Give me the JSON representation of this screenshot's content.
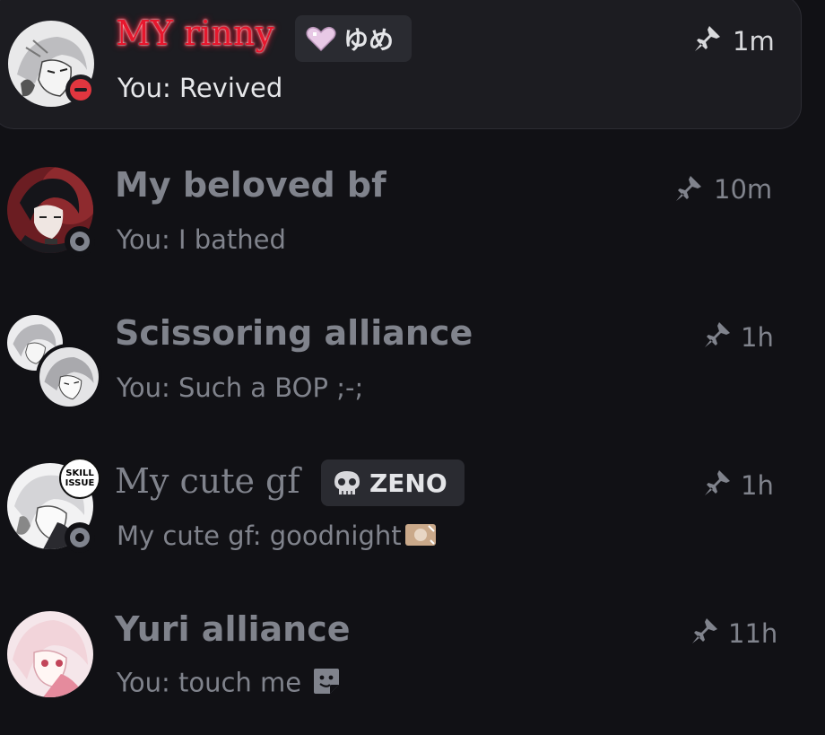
{
  "conversations": [
    {
      "name": "MY rinny",
      "tag": {
        "icon": "heart-icon",
        "label": "ゆめ"
      },
      "preview": "You: Revived",
      "time": "1m",
      "status": "dnd",
      "active": true
    },
    {
      "name": "My beloved bf",
      "preview": "You: I bathed",
      "time": "10m",
      "status": "offline"
    },
    {
      "name": "Scissoring alliance",
      "preview": "You: Such a BOP ;-;",
      "time": "1h"
    },
    {
      "name": "My cute gf",
      "tag": {
        "icon": "skull-icon",
        "label": "ZENO"
      },
      "avatar_badge": "SKILL ISSUE",
      "preview": "My cute gf: goodnight",
      "time": "1h",
      "status": "offline"
    },
    {
      "name": "Yuri alliance",
      "preview": "You: touch me",
      "time": "11h"
    }
  ],
  "colors": {
    "background": "#111115",
    "active_row": "#1c1c21",
    "muted_text": "#80838c",
    "dnd_status": "#e0363f",
    "offline_status": "#80848e",
    "tag_bg": "#2a2b31",
    "highlight_name": "#e7172d"
  }
}
